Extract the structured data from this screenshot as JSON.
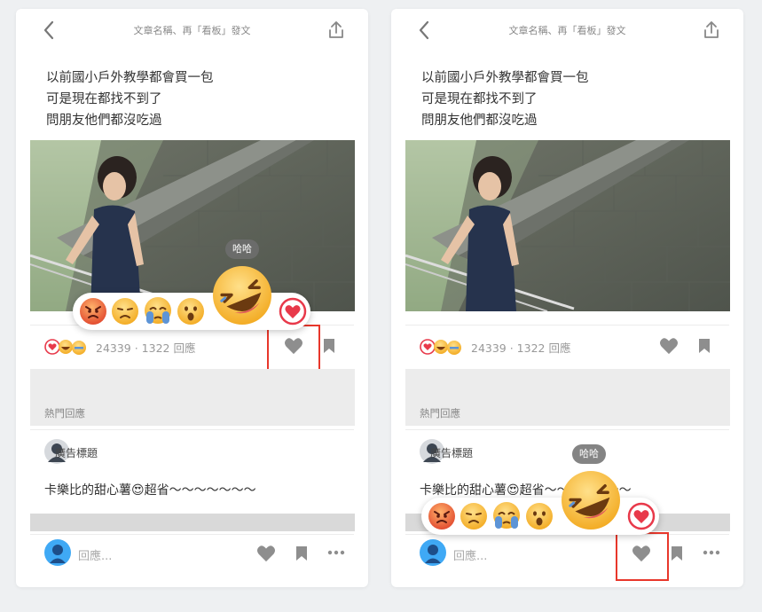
{
  "cards": [
    {
      "header": {
        "title": "文章名稱、再「看板」發文"
      },
      "post_lines": [
        "以前國小戶外教學都會買一包",
        "可是現在都找不到了",
        "問朋友他們都沒吃過"
      ],
      "stats": "24339 · 1322 回應",
      "hot_label": "熱門回應",
      "comment": {
        "author": "廣告標題",
        "text": "卡樂比的甜心薯😍超省～～～～～～～"
      },
      "reply_placeholder": "回應...",
      "reaction_tooltip": "哈哈"
    },
    {
      "header": {
        "title": "文章名稱、再「看板」發文"
      },
      "post_lines": [
        "以前國小戶外教學都會買一包",
        "可是現在都找不到了",
        "問朋友他們都沒吃過"
      ],
      "stats": "24339 · 1322 回應",
      "hot_label": "熱門回應",
      "comment": {
        "author": "廣告標題",
        "text": "卡樂比的甜心薯😍超省～～～～～～～"
      },
      "reply_placeholder": "回應...",
      "reaction_tooltip": "哈哈"
    }
  ],
  "icons": [
    "back-arrow-icon",
    "share-icon",
    "heart-icon",
    "bookmark-icon",
    "more-icon",
    "angry-face-icon",
    "sad-face-icon",
    "crying-face-icon",
    "wow-face-icon",
    "laugh-face-icon",
    "heart-outline-icon"
  ],
  "colors": {
    "highlight_box": "#e8372b",
    "reaction_yellow": "#f7b733",
    "heart_red": "#e8394a",
    "background": "#eef0f2"
  }
}
